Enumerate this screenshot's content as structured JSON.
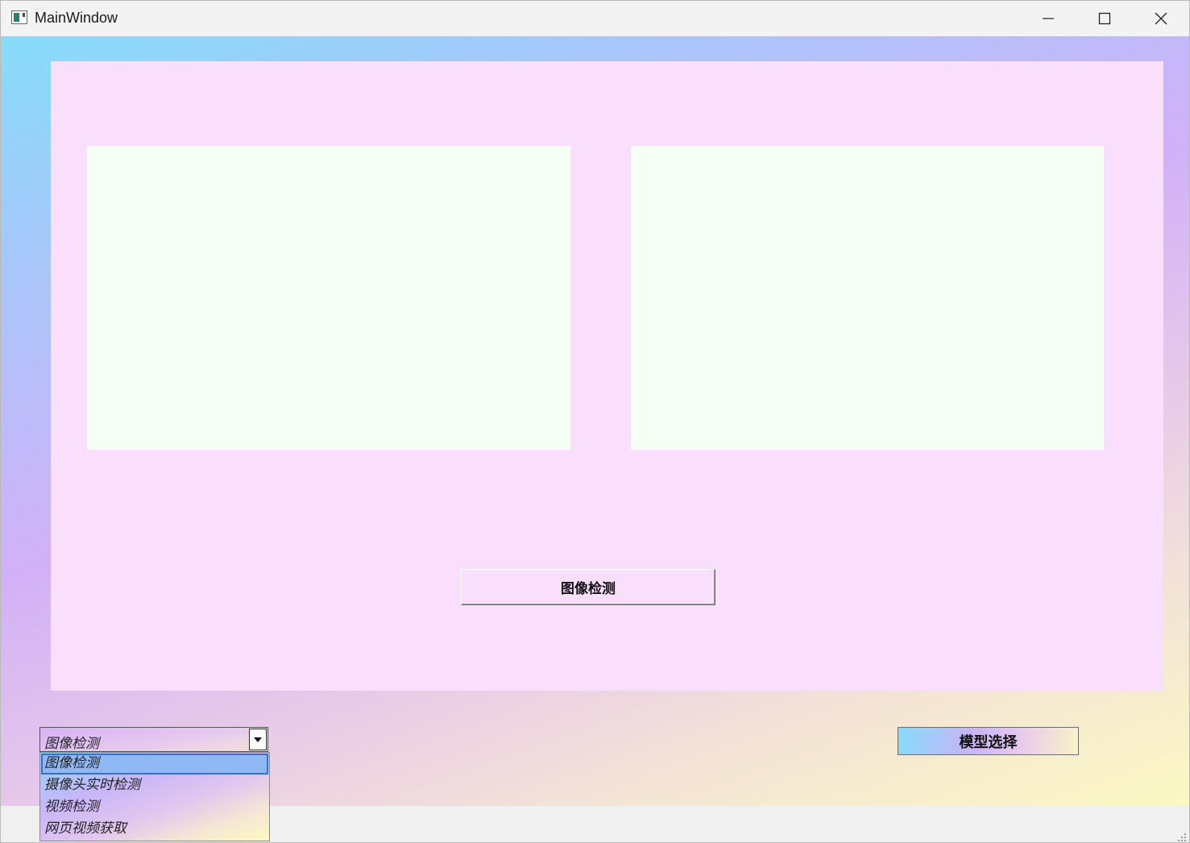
{
  "window": {
    "title": "MainWindow",
    "minimize_icon": "minimize-icon",
    "maximize_icon": "maximize-icon",
    "close_icon": "close-icon"
  },
  "main": {
    "detect_button_label": "图像检测",
    "model_button_label": "模型选择"
  },
  "mode_combo": {
    "selected": "图像检测",
    "options": [
      "图像检测",
      "摄像头实时检测",
      "视频检测",
      "网页视频获取"
    ],
    "highlighted_index": 0
  },
  "colors": {
    "panel_bg": "#fadffd",
    "frame_bg": "#f5fff3",
    "gradient_start": "#86dcfb",
    "gradient_end": "#fbf8c2"
  }
}
